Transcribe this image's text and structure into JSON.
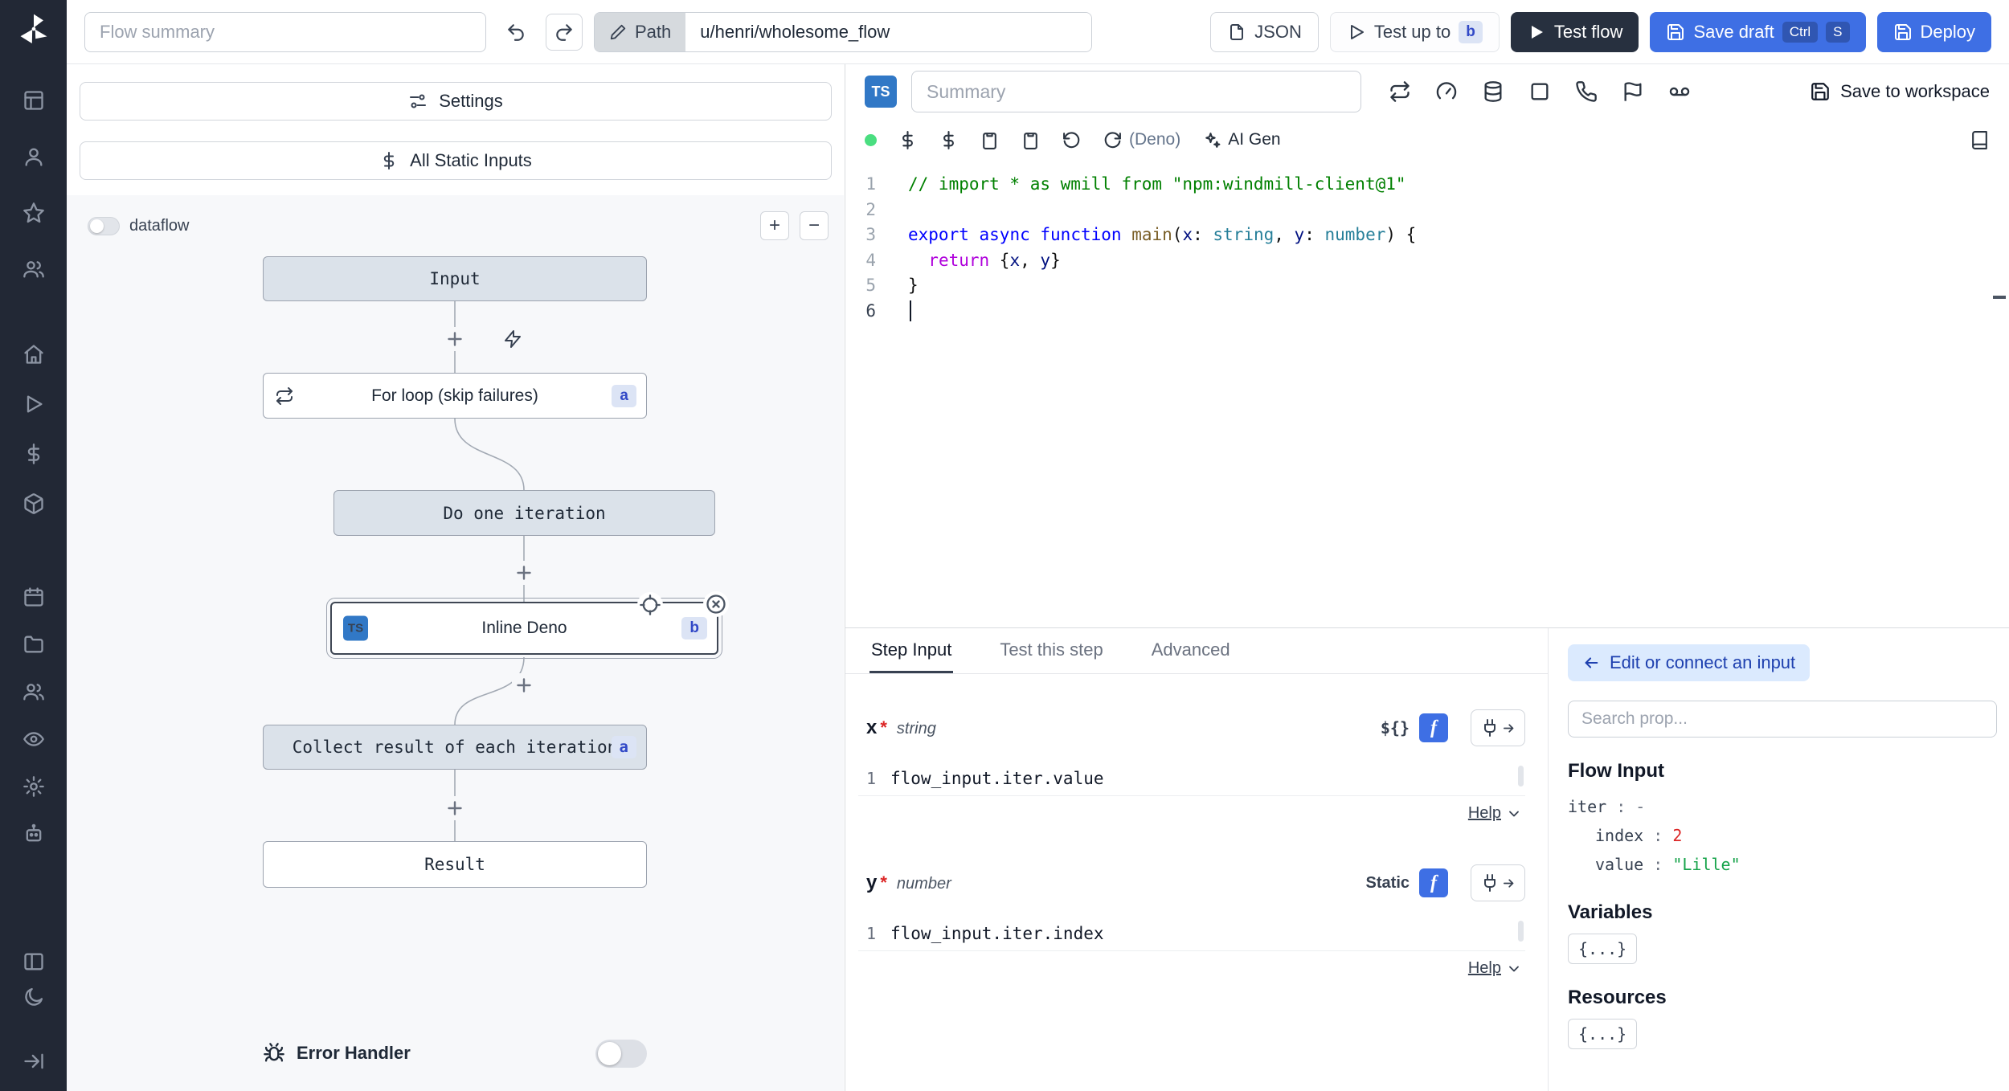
{
  "colors": {
    "accent_blue": "#3e6fe4",
    "sidebar_bg": "#222835",
    "node_fill": "#dbe2ea",
    "badge_bg": "#dce4f5",
    "badge_text": "#3249c7",
    "status_green": "#4ade80",
    "number_red": "#dc2626",
    "string_green": "#16a34a"
  },
  "sidebar": {
    "icons": [
      "windmill-logo",
      "table",
      "user",
      "star",
      "users",
      "home",
      "play",
      "dollar",
      "cube",
      "calendar",
      "folder",
      "users",
      "eye",
      "gear",
      "bot",
      "columns",
      "moon",
      "arrow-right"
    ]
  },
  "topbar": {
    "flow_summary_placeholder": "Flow summary",
    "path_label": "Path",
    "path_value": "u/henri/wholesome_flow",
    "json_label": "JSON",
    "test_up_to_label": "Test up to",
    "test_up_to_badge": "b",
    "test_flow_label": "Test flow",
    "save_draft_label": "Save draft",
    "kbd_ctrl": "Ctrl",
    "kbd_s": "S",
    "deploy_label": "Deploy"
  },
  "flow": {
    "settings_label": "Settings",
    "static_inputs_label": "All Static Inputs",
    "dataflow_label": "dataflow",
    "zoom_in_label": "+",
    "zoom_out_label": "−",
    "nodes": {
      "input": "Input",
      "forloop": "For loop (skip failures)",
      "forloop_badge": "a",
      "iteration": "Do one iteration",
      "inline": "Inline Deno",
      "inline_lang": "TS",
      "inline_badge": "b",
      "collect": "Collect result of each iteration",
      "collect_badge": "a",
      "result": "Result"
    },
    "error_handler_label": "Error Handler"
  },
  "editor": {
    "lang_badge": "TS",
    "summary_placeholder": "Summary",
    "language_label": "(Deno)",
    "ai_gen_label": "AI Gen",
    "save_to_workspace_label": "Save to workspace",
    "code_lines": [
      [
        {
          "c": "cmt",
          "t": "// import * as wmill from \"npm:windmill-client@1\""
        }
      ],
      [],
      [
        {
          "c": "kw",
          "t": "export"
        },
        {
          "c": "pl",
          "t": " "
        },
        {
          "c": "kw",
          "t": "async"
        },
        {
          "c": "pl",
          "t": " "
        },
        {
          "c": "kw",
          "t": "function"
        },
        {
          "c": "pl",
          "t": " "
        },
        {
          "c": "fn",
          "t": "main"
        },
        {
          "c": "pl",
          "t": "("
        },
        {
          "c": "pm",
          "t": "x"
        },
        {
          "c": "pl",
          "t": ": "
        },
        {
          "c": "ty",
          "t": "string"
        },
        {
          "c": "pl",
          "t": ", "
        },
        {
          "c": "pm",
          "t": "y"
        },
        {
          "c": "pl",
          "t": ": "
        },
        {
          "c": "ty",
          "t": "number"
        },
        {
          "c": "pl",
          "t": ") {"
        }
      ],
      [
        {
          "c": "pl",
          "t": "  "
        },
        {
          "c": "ct",
          "t": "return"
        },
        {
          "c": "pl",
          "t": " {"
        },
        {
          "c": "pm",
          "t": "x"
        },
        {
          "c": "pl",
          "t": ", "
        },
        {
          "c": "pm",
          "t": "y"
        },
        {
          "c": "pl",
          "t": "}"
        }
      ],
      [
        {
          "c": "pl",
          "t": "}"
        }
      ],
      []
    ]
  },
  "step": {
    "tabs": [
      "Step Input",
      "Test this step",
      "Advanced"
    ],
    "help_label": "Help",
    "fields": [
      {
        "name": "x",
        "required": "*",
        "type": "string",
        "mode": "${}",
        "line_no": "1",
        "value": "flow_input.iter.value"
      },
      {
        "name": "y",
        "required": "*",
        "type": "number",
        "mode": "Static",
        "line_no": "1",
        "value": "flow_input.iter.index"
      }
    ]
  },
  "connect": {
    "title": "Edit or connect an input",
    "search_placeholder": "Search prop...",
    "flow_input_title": "Flow Input",
    "separator": " : ",
    "props": [
      {
        "key": "iter",
        "value": "-",
        "color": "#6b7280",
        "indent": false
      },
      {
        "key": "index",
        "value": "2",
        "color": "#dc2626",
        "indent": true
      },
      {
        "key": "value",
        "value": "\"Lille\"",
        "color": "#16a34a",
        "indent": true
      }
    ],
    "variables_title": "Variables",
    "variables_value": "{...}",
    "resources_title": "Resources",
    "resources_value": "{...}"
  }
}
